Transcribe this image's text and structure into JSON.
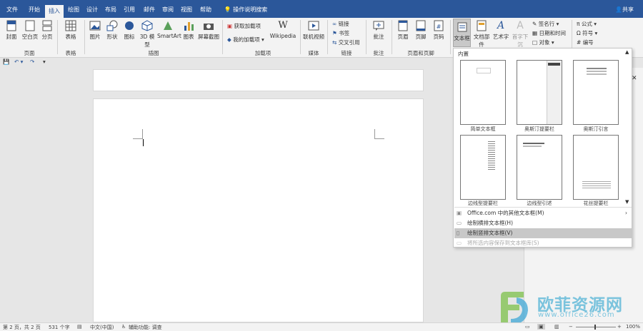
{
  "tabs": [
    "文件",
    "开始",
    "插入",
    "绘图",
    "设计",
    "布局",
    "引用",
    "邮件",
    "审阅",
    "视图",
    "帮助"
  ],
  "tell_me": "操作说明搜索",
  "share": "共享",
  "ribbon": {
    "pages": {
      "cover": "封面",
      "blank": "空白页",
      "break": "分页",
      "label": "页面"
    },
    "tables": {
      "table": "表格",
      "label": "表格"
    },
    "illustrations": {
      "picture": "图片",
      "shapes": "形状",
      "icons": "图标",
      "models3d": "3D 模型",
      "smartart": "SmartArt",
      "chart": "图表",
      "screenshot": "屏幕截图",
      "label": "插图"
    },
    "addins": {
      "get": "获取加载项",
      "mine": "我的加载项",
      "wiki": "Wikipedia",
      "label": "加载项"
    },
    "media": {
      "video": "联机视频",
      "label": "媒体"
    },
    "links": {
      "link": "链接",
      "bookmark": "书签",
      "cross": "交叉引用",
      "label": "链接"
    },
    "comments": {
      "comment": "批注",
      "label": "批注"
    },
    "header_footer": {
      "header": "页眉",
      "footer": "页脚",
      "page_no": "页码",
      "label": "页眉和页脚"
    },
    "text": {
      "textbox": "文本框",
      "quickparts": "文档部件",
      "wordart": "艺术字",
      "dropcap": "首字下沉"
    },
    "text_small": {
      "signature": "签名行",
      "datetime": "日期和时间",
      "object": "对象"
    },
    "symbols": {
      "equation": "公式",
      "symbol": "符号",
      "number": "编号"
    }
  },
  "dropdown": {
    "section": "内置",
    "thumbs": [
      "简单文本框",
      "奥斯汀提要栏",
      "奥斯汀引言",
      "边线型提要栏",
      "边线型引述",
      "花丝提要栏"
    ],
    "menu": [
      "Office.com 中的其他文本框(M)",
      "绘制横排文本框(H)",
      "绘制竖排文本框(V)",
      "将所选内容保存到文本框库(S)"
    ]
  },
  "status": {
    "page": "第 2 页，共 2 页",
    "words": "531 个字",
    "lang": "中文(中国)",
    "access": "辅助功能: 调查",
    "zoom": "100%"
  },
  "watermark": {
    "brand": "欧菲资源网",
    "url": "www.office26.com"
  },
  "colors": {
    "accent": "#2b579a",
    "hover": "#c8c8c8",
    "watermark": "#5db8d8"
  }
}
